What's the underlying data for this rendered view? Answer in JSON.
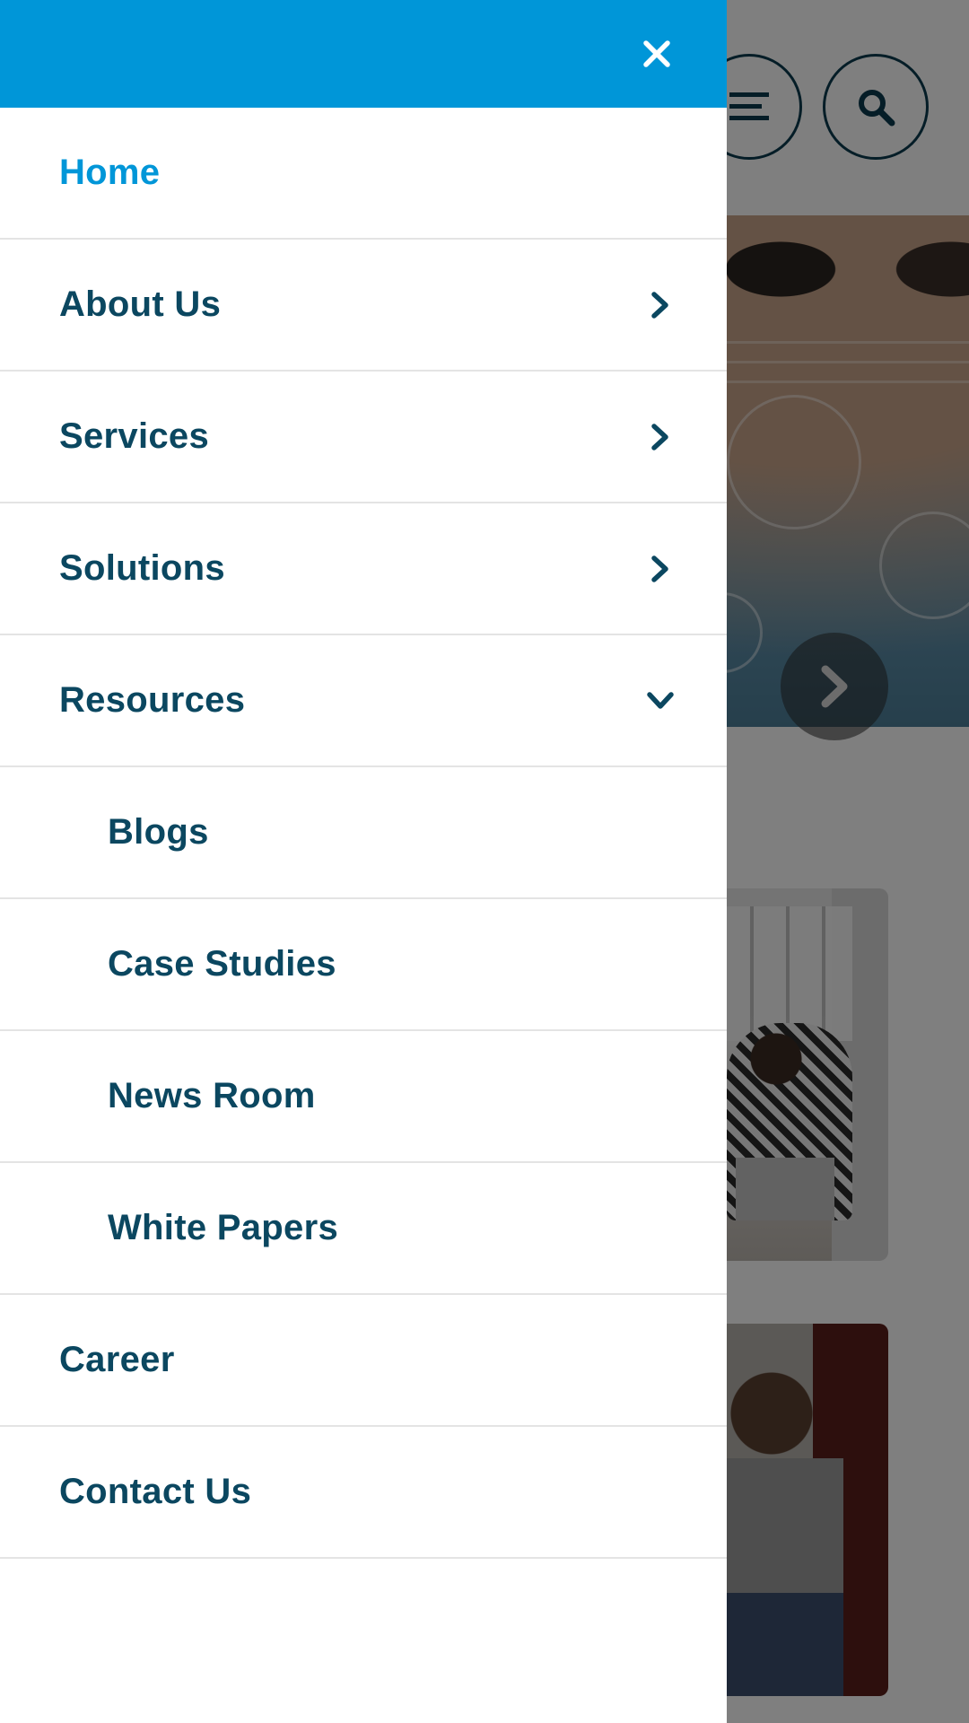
{
  "drawer": {
    "header_color": "#0096d8",
    "close_icon": "close-icon",
    "items": [
      {
        "label": "Home",
        "active": true,
        "icon": null
      },
      {
        "label": "About Us",
        "icon": "chevron-right-icon"
      },
      {
        "label": "Services",
        "icon": "chevron-right-icon"
      },
      {
        "label": "Solutions",
        "icon": "chevron-right-icon"
      },
      {
        "label": "Resources",
        "icon": "chevron-down-icon",
        "expanded": true
      },
      {
        "label": "Blogs",
        "sub": true
      },
      {
        "label": "Case Studies",
        "sub": true
      },
      {
        "label": "News Room",
        "sub": true
      },
      {
        "label": "White Papers",
        "sub": true
      },
      {
        "label": "Career"
      },
      {
        "label": "Contact Us"
      }
    ]
  },
  "background_page": {
    "icons": [
      "hamburger-menu-icon",
      "search-icon",
      "chevron-right-icon"
    ],
    "accent_color": "#0a3b4e"
  }
}
